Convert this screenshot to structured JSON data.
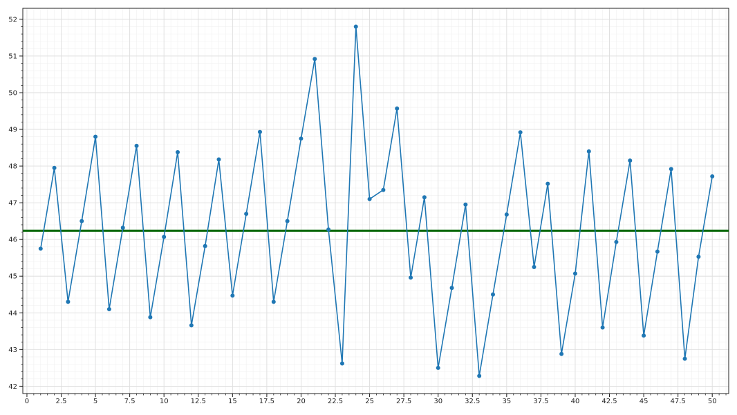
{
  "chart_data": {
    "type": "line",
    "title": "",
    "xlabel": "",
    "ylabel": "",
    "xlim": [
      -0.3,
      51.2
    ],
    "ylim": [
      41.8,
      52.3
    ],
    "grid": true,
    "x_ticks": [
      0,
      2.5,
      5,
      7.5,
      10,
      12.5,
      15,
      17.5,
      20,
      22.5,
      25,
      27.5,
      30,
      32.5,
      35,
      37.5,
      40,
      42.5,
      45,
      47.5,
      50
    ],
    "x_tick_labels": [
      "0",
      "2.5",
      "5",
      "7.5",
      "10",
      "12.5",
      "15",
      "17.5",
      "20",
      "22.5",
      "25",
      "27.5",
      "30",
      "32.5",
      "35",
      "37.5",
      "40",
      "42.5",
      "45",
      "47.5",
      "50"
    ],
    "y_ticks": [
      42,
      43,
      44,
      45,
      46,
      47,
      48,
      49,
      50,
      51,
      52
    ],
    "y_tick_labels": [
      "42",
      "43",
      "44",
      "45",
      "46",
      "47",
      "48",
      "49",
      "50",
      "51",
      "52"
    ],
    "series": [
      {
        "color": "#1f77b4",
        "x": [
          1,
          2,
          3,
          4,
          5,
          6,
          7,
          8,
          9,
          10,
          11,
          12,
          13,
          14,
          15,
          16,
          17,
          18,
          19,
          20,
          21,
          22,
          23,
          24,
          25,
          26,
          27,
          28,
          29,
          30,
          31,
          32,
          33,
          34,
          35,
          36,
          37,
          38,
          39,
          40,
          41,
          42,
          43,
          44,
          45,
          46,
          47,
          48,
          49,
          50
        ],
        "y": [
          45.75,
          47.95,
          44.3,
          46.5,
          48.8,
          44.1,
          46.32,
          48.55,
          43.88,
          46.07,
          48.38,
          43.66,
          45.82,
          48.18,
          44.47,
          46.7,
          48.93,
          44.3,
          46.5,
          48.75,
          50.92,
          46.27,
          42.62,
          51.8,
          47.1,
          47.35,
          49.57,
          44.96,
          47.15,
          42.5,
          44.68,
          46.95,
          42.28,
          44.5,
          46.68,
          48.92,
          45.25,
          47.52,
          42.88,
          45.07,
          48.4,
          43.6,
          45.93,
          48.15,
          43.38,
          45.67,
          47.92,
          42.75,
          45.53,
          47.72
        ]
      }
    ],
    "reference_line": {
      "y": 46.24,
      "color": "#006400"
    }
  }
}
